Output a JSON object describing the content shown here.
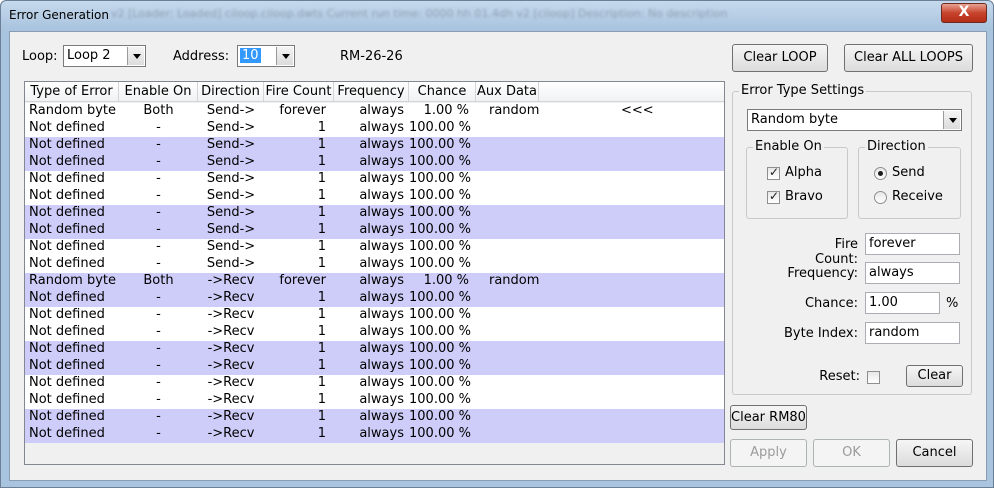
{
  "window": {
    "title": "Error Generation",
    "title_extra": "v2 [Loader: Loaded] ciloop.ciloop.dwts    Current run time: 0000 hh 01.4dh    v2 [ciloop]    Description:  No description provided",
    "close_label": "X"
  },
  "top": {
    "loop_label": "Loop:",
    "loop_value": "Loop 2",
    "address_label": "Address:",
    "address_value": "10",
    "rm_label": "RM-26-26"
  },
  "buttons": {
    "clear_loop": "Clear LOOP",
    "clear_all_loops": "Clear ALL LOOPS",
    "clear_rm80": "Clear RM80",
    "apply": "Apply",
    "ok": "OK",
    "cancel": "Cancel",
    "clear": "Clear"
  },
  "table": {
    "columns": [
      "Type of Error",
      "Enable On",
      "Direction",
      "Fire Count",
      "Frequency",
      "Chance",
      "Aux Data"
    ],
    "rows": [
      [
        "Random byte",
        "Both",
        "Send->",
        "forever",
        "always",
        "1.00 %",
        "random",
        "<<<"
      ],
      [
        "Not defined",
        "-",
        "Send->",
        "1",
        "always",
        "100.00 %",
        "",
        ""
      ],
      [
        "Not defined",
        "-",
        "Send->",
        "1",
        "always",
        "100.00 %",
        "",
        ""
      ],
      [
        "Not defined",
        "-",
        "Send->",
        "1",
        "always",
        "100.00 %",
        "",
        ""
      ],
      [
        "Not defined",
        "-",
        "Send->",
        "1",
        "always",
        "100.00 %",
        "",
        ""
      ],
      [
        "Not defined",
        "-",
        "Send->",
        "1",
        "always",
        "100.00 %",
        "",
        ""
      ],
      [
        "Not defined",
        "-",
        "Send->",
        "1",
        "always",
        "100.00 %",
        "",
        ""
      ],
      [
        "Not defined",
        "-",
        "Send->",
        "1",
        "always",
        "100.00 %",
        "",
        ""
      ],
      [
        "Not defined",
        "-",
        "Send->",
        "1",
        "always",
        "100.00 %",
        "",
        ""
      ],
      [
        "Not defined",
        "-",
        "Send->",
        "1",
        "always",
        "100.00 %",
        "",
        ""
      ],
      [
        "Random byte",
        "Both",
        "->Recv",
        "forever",
        "always",
        "1.00 %",
        "random",
        ""
      ],
      [
        "Not defined",
        "-",
        "->Recv",
        "1",
        "always",
        "100.00 %",
        "",
        ""
      ],
      [
        "Not defined",
        "-",
        "->Recv",
        "1",
        "always",
        "100.00 %",
        "",
        ""
      ],
      [
        "Not defined",
        "-",
        "->Recv",
        "1",
        "always",
        "100.00 %",
        "",
        ""
      ],
      [
        "Not defined",
        "-",
        "->Recv",
        "1",
        "always",
        "100.00 %",
        "",
        ""
      ],
      [
        "Not defined",
        "-",
        "->Recv",
        "1",
        "always",
        "100.00 %",
        "",
        ""
      ],
      [
        "Not defined",
        "-",
        "->Recv",
        "1",
        "always",
        "100.00 %",
        "",
        ""
      ],
      [
        "Not defined",
        "-",
        "->Recv",
        "1",
        "always",
        "100.00 %",
        "",
        ""
      ],
      [
        "Not defined",
        "-",
        "->Recv",
        "1",
        "always",
        "100.00 %",
        "",
        ""
      ],
      [
        "Not defined",
        "-",
        "->Recv",
        "1",
        "always",
        "100.00 %",
        "",
        ""
      ]
    ]
  },
  "settings": {
    "group_title": "Error Type Settings",
    "type_value": "Random byte",
    "enable_on_title": "Enable On",
    "alpha_label": "Alpha",
    "bravo_label": "Bravo",
    "direction_title": "Direction",
    "send_label": "Send",
    "receive_label": "Receive",
    "fire_count_label": "Fire Count:",
    "fire_count_value": "forever",
    "frequency_label": "Frequency:",
    "frequency_value": "always",
    "chance_label": "Chance:",
    "chance_value": "1.00",
    "chance_unit": "%",
    "byte_index_label": "Byte Index:",
    "byte_index_value": "random",
    "reset_label": "Reset:"
  },
  "colors": {
    "row_alt": "#cecdf9",
    "row_white": "#ffffff",
    "address_highlight": "#3399ff"
  }
}
